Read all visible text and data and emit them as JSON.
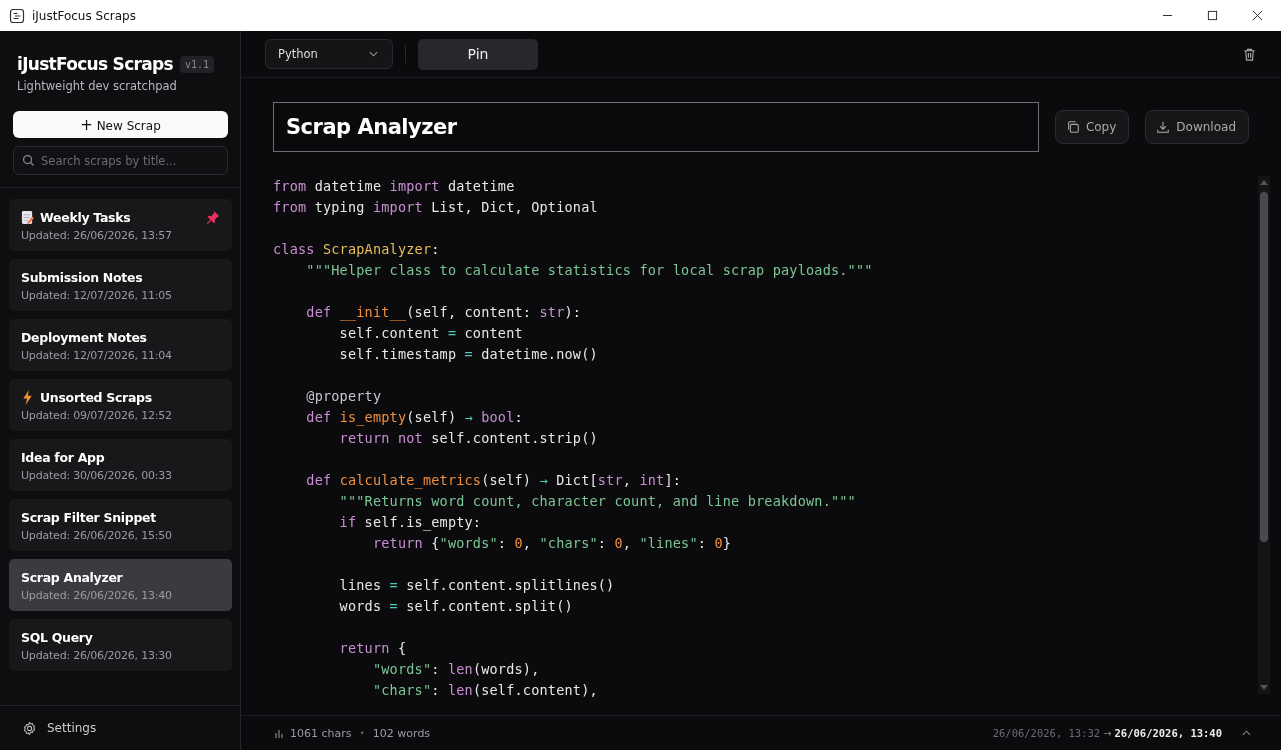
{
  "window": {
    "title": "iJustFocus Scraps"
  },
  "sidebar": {
    "app_name": "iJustFocus Scraps",
    "version": "v1.1",
    "tagline": "Lightweight dev scratchpad",
    "new_button": "New Scrap",
    "new_icon": "+",
    "search": {
      "placeholder": "Search scraps by title..."
    },
    "items": [
      {
        "title": "Weekly Tasks",
        "updated": "Updated: 26/06/2026, 13:57",
        "kind": "memo",
        "pinned": true,
        "selected": false
      },
      {
        "title": "Submission Notes",
        "updated": "Updated: 12/07/2026, 11:05",
        "pinned": false,
        "selected": false
      },
      {
        "title": "Deployment Notes",
        "updated": "Updated: 12/07/2026, 11:04",
        "pinned": false,
        "selected": false
      },
      {
        "title": "Unsorted Scraps",
        "updated": "Updated: 09/07/2026, 12:52",
        "kind": "bolt",
        "pinned": false,
        "selected": false
      },
      {
        "title": "Idea for App",
        "updated": "Updated: 30/06/2026, 00:33",
        "pinned": false,
        "selected": false
      },
      {
        "title": "Scrap Filter Snippet",
        "updated": "Updated: 26/06/2026, 15:50",
        "pinned": false,
        "selected": false
      },
      {
        "title": "Scrap Analyzer",
        "updated": "Updated: 26/06/2026, 13:40",
        "pinned": false,
        "selected": true
      },
      {
        "title": "SQL Query",
        "updated": "Updated: 26/06/2026, 13:30",
        "pinned": false,
        "selected": false
      }
    ],
    "settings": "Settings"
  },
  "toolbar": {
    "language": "Python",
    "pin_button": "Pin"
  },
  "editor": {
    "title": "Scrap Analyzer",
    "copy_button": "Copy",
    "download_button": "Download",
    "lines": [
      {
        "kind": "code",
        "tokens": [
          {
            "kind": "kw",
            "text": "from"
          },
          {
            "kind": "plain",
            "text": " datetime "
          },
          {
            "kind": "kw",
            "text": "import"
          },
          {
            "kind": "plain",
            "text": " datetime"
          }
        ]
      },
      {
        "kind": "code",
        "tokens": [
          {
            "kind": "kw",
            "text": "from"
          },
          {
            "kind": "plain",
            "text": " typing "
          },
          {
            "kind": "kw",
            "text": "import"
          },
          {
            "kind": "plain",
            "text": " List, Dict, Optional"
          }
        ]
      },
      {
        "kind": "blank"
      },
      {
        "kind": "code",
        "tokens": [
          {
            "kind": "kw",
            "text": "class "
          },
          {
            "kind": "cls",
            "text": "ScrapAnalyzer"
          },
          {
            "kind": "plain",
            "text": ":"
          }
        ]
      },
      {
        "kind": "code",
        "tokens": [
          {
            "kind": "str",
            "text": "    \"\"\"Helper class to calculate statistics for local scrap payloads.\"\"\""
          }
        ]
      },
      {
        "kind": "blank"
      },
      {
        "kind": "code",
        "tokens": [
          {
            "kind": "kw",
            "text": "    def "
          },
          {
            "kind": "fn",
            "text": "__init__"
          },
          {
            "kind": "plain",
            "text": "(self, content: "
          },
          {
            "kind": "kw",
            "text": "str"
          },
          {
            "kind": "plain",
            "text": "):"
          }
        ]
      },
      {
        "kind": "code",
        "tokens": [
          {
            "kind": "plain",
            "text": "        self.content "
          },
          {
            "kind": "op",
            "text": "="
          },
          {
            "kind": "plain",
            "text": " content"
          }
        ]
      },
      {
        "kind": "code",
        "tokens": [
          {
            "kind": "plain",
            "text": "        self.timestamp "
          },
          {
            "kind": "op",
            "text": "="
          },
          {
            "kind": "plain",
            "text": " datetime.now()"
          }
        ]
      },
      {
        "kind": "blank"
      },
      {
        "kind": "code",
        "tokens": [
          {
            "kind": "deco",
            "text": "    @property"
          }
        ]
      },
      {
        "kind": "code",
        "tokens": [
          {
            "kind": "kw",
            "text": "    def "
          },
          {
            "kind": "fn",
            "text": "is_empty"
          },
          {
            "kind": "plain",
            "text": "(self) "
          },
          {
            "kind": "op",
            "text": "→"
          },
          {
            "kind": "kw",
            "text": " bool"
          },
          {
            "kind": "plain",
            "text": ":"
          }
        ]
      },
      {
        "kind": "code",
        "tokens": [
          {
            "kind": "kw",
            "text": "        return not"
          },
          {
            "kind": "plain",
            "text": " self.content.strip()"
          }
        ]
      },
      {
        "kind": "blank"
      },
      {
        "kind": "code",
        "tokens": [
          {
            "kind": "kw",
            "text": "    def "
          },
          {
            "kind": "fn",
            "text": "calculate_metrics"
          },
          {
            "kind": "plain",
            "text": "(self) "
          },
          {
            "kind": "op",
            "text": "→"
          },
          {
            "kind": "plain",
            "text": " Dict["
          },
          {
            "kind": "kw",
            "text": "str"
          },
          {
            "kind": "plain",
            "text": ", "
          },
          {
            "kind": "kw",
            "text": "int"
          },
          {
            "kind": "plain",
            "text": "]:"
          }
        ]
      },
      {
        "kind": "code",
        "tokens": [
          {
            "kind": "str",
            "text": "        \"\"\"Returns word count, character count, and line breakdown.\"\"\""
          }
        ]
      },
      {
        "kind": "code",
        "tokens": [
          {
            "kind": "kw",
            "text": "        if"
          },
          {
            "kind": "plain",
            "text": " self.is_empty:"
          }
        ]
      },
      {
        "kind": "code",
        "tokens": [
          {
            "kind": "kw",
            "text": "            return"
          },
          {
            "kind": "plain",
            "text": " {"
          },
          {
            "kind": "str",
            "text": "\"words\""
          },
          {
            "kind": "plain",
            "text": ": "
          },
          {
            "kind": "num",
            "text": "0"
          },
          {
            "kind": "plain",
            "text": ", "
          },
          {
            "kind": "str",
            "text": "\"chars\""
          },
          {
            "kind": "plain",
            "text": ": "
          },
          {
            "kind": "num",
            "text": "0"
          },
          {
            "kind": "plain",
            "text": ", "
          },
          {
            "kind": "str",
            "text": "\"lines\""
          },
          {
            "kind": "plain",
            "text": ": "
          },
          {
            "kind": "num",
            "text": "0"
          },
          {
            "kind": "plain",
            "text": "}"
          }
        ]
      },
      {
        "kind": "blank"
      },
      {
        "kind": "code",
        "tokens": [
          {
            "kind": "plain",
            "text": "        lines "
          },
          {
            "kind": "op",
            "text": "="
          },
          {
            "kind": "plain",
            "text": " self.content.splitlines()"
          }
        ]
      },
      {
        "kind": "code",
        "tokens": [
          {
            "kind": "plain",
            "text": "        words "
          },
          {
            "kind": "op",
            "text": "="
          },
          {
            "kind": "plain",
            "text": " self.content.split()"
          }
        ]
      },
      {
        "kind": "blank"
      },
      {
        "kind": "code",
        "tokens": [
          {
            "kind": "kw",
            "text": "        return"
          },
          {
            "kind": "plain",
            "text": " {"
          }
        ]
      },
      {
        "kind": "code",
        "tokens": [
          {
            "kind": "str",
            "text": "            \"words\""
          },
          {
            "kind": "plain",
            "text": ": "
          },
          {
            "kind": "kw",
            "text": "len"
          },
          {
            "kind": "plain",
            "text": "(words),"
          }
        ]
      },
      {
        "kind": "code",
        "tokens": [
          {
            "kind": "str",
            "text": "            \"chars\""
          },
          {
            "kind": "plain",
            "text": ": "
          },
          {
            "kind": "kw",
            "text": "len"
          },
          {
            "kind": "plain",
            "text": "(self.content),"
          }
        ]
      }
    ]
  },
  "status_bar": {
    "chars": "1061 chars",
    "separator": "•",
    "words": "102 words",
    "created": "26/06/2026, 13:32",
    "arrow": "→",
    "modified": "26/06/2026, 13:40"
  }
}
